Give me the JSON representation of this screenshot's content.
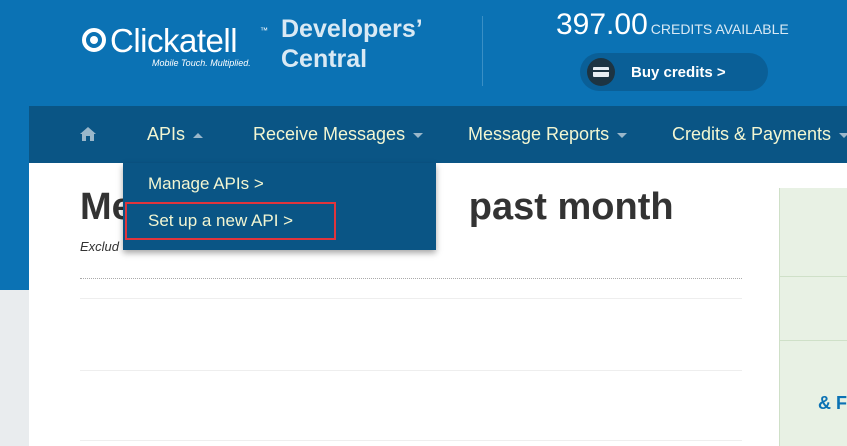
{
  "brand": {
    "name": "Clickatell",
    "trademark": "™",
    "tagline": "Mobile Touch. Multiplied.",
    "section_line1": "Developers’",
    "section_line2": "Central"
  },
  "credits": {
    "amount": "397.00",
    "label": "CREDITS AVAILABLE",
    "buy_label": "Buy credits >"
  },
  "nav": {
    "items": [
      {
        "label": "APIs"
      },
      {
        "label": "Receive Messages"
      },
      {
        "label": "Message Reports"
      },
      {
        "label": "Credits & Payments"
      }
    ]
  },
  "dropdown": {
    "items": [
      {
        "label": "Manage APIs >"
      },
      {
        "label": "Set up a new API >"
      }
    ]
  },
  "page": {
    "title_left": "Me",
    "title_right": "past month",
    "subtitle_visible": "Exclud"
  },
  "side": {
    "text": "& F"
  },
  "colors": {
    "header_bg": "#0b72b4",
    "nav_bg": "#0a5585",
    "nav_text": "#f2f6d2",
    "highlight": "#e0353c"
  }
}
